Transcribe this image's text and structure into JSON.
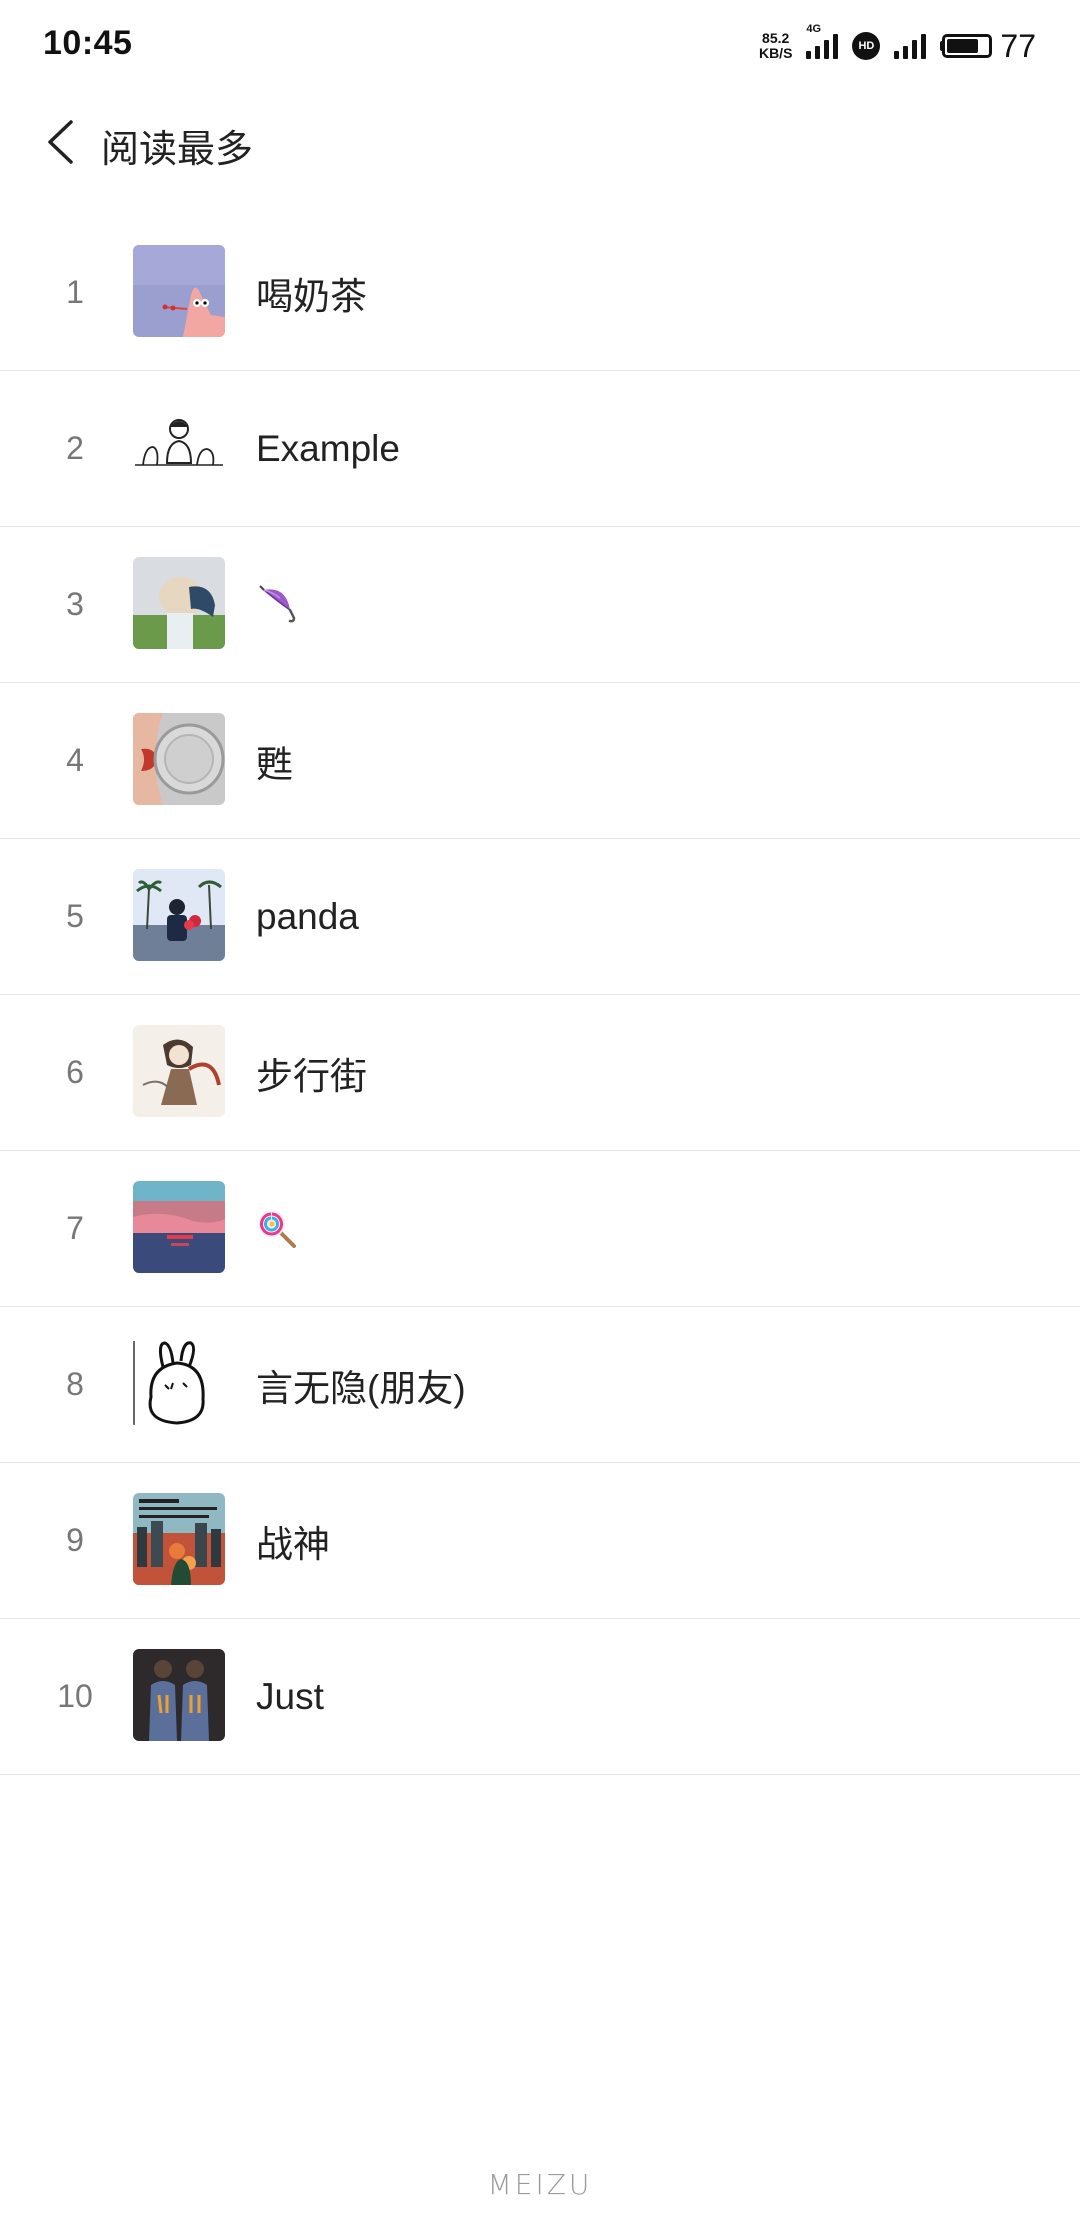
{
  "status_bar": {
    "time": "10:45",
    "net_speed_value": "85.2",
    "net_speed_unit": "KB/S",
    "network_type": "4G",
    "hd_label": "HD",
    "battery_percent": "77",
    "battery_level": 0.77
  },
  "header": {
    "title": "阅读最多",
    "back_icon": "chevron-left-icon"
  },
  "list": [
    {
      "rank": "1",
      "name": "喝奶茶",
      "avatar": "patrick-star-avatar"
    },
    {
      "rank": "2",
      "name": "Example",
      "avatar": "line-drawing-family-avatar"
    },
    {
      "rank": "3",
      "name": "",
      "name_icon": "umbrella-emoji",
      "avatar": "girl-with-cat-avatar"
    },
    {
      "rank": "4",
      "name": "甦",
      "avatar": "lips-glass-avatar"
    },
    {
      "rank": "5",
      "name": "panda",
      "avatar": "beach-palm-avatar"
    },
    {
      "rank": "6",
      "name": "步行街",
      "avatar": "anime-character-avatar"
    },
    {
      "rank": "7",
      "name": "",
      "name_icon": "lollipop-emoji",
      "avatar": "sunset-sea-avatar"
    },
    {
      "rank": "8",
      "name": "言无隐(朋友)",
      "avatar": "bunny-sketch-avatar"
    },
    {
      "rank": "9",
      "name": "战神",
      "avatar": "city-text-avatar"
    },
    {
      "rank": "10",
      "name": "Just",
      "avatar": "basketball-players-avatar"
    }
  ],
  "footer": {
    "brand": "MEIZU"
  }
}
